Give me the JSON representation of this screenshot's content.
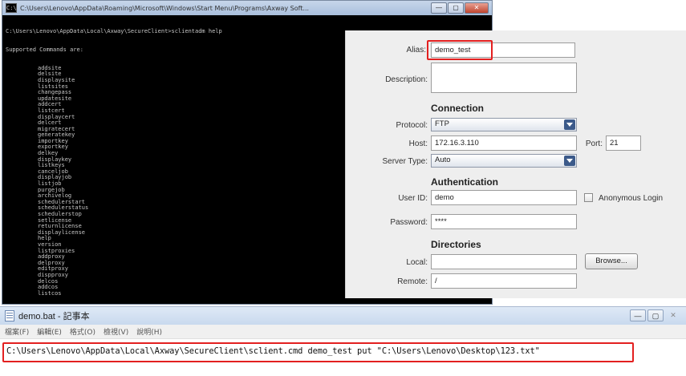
{
  "console": {
    "title": "C:\\Users\\Lenovo\\AppData\\Roaming\\Microsoft\\Windows\\Start Menu\\Programs\\Axway Soft...",
    "prompt_line": "C:\\Users\\Lenovo\\AppData\\Local\\Axway\\SecureClient>sclientadm help",
    "supported_line": "Supported Commands are:",
    "commands": [
      "addsite",
      "delsite",
      "displaysite",
      "listsites",
      "changepass",
      "updatesite",
      "addcert",
      "listcert",
      "displaycert",
      "delcert",
      "migratecert",
      "generatekey",
      "importkey",
      "exportkey",
      "delkey",
      "displaykey",
      "listkeys",
      "canceljob",
      "displayjob",
      "listjob",
      "purgejob",
      "archivelog",
      "schedulerstart",
      "schedulerstatus",
      "schedulerstop",
      "setlicense",
      "returnlicense",
      "displaylicense",
      "help",
      "version",
      "listproxies",
      "addproxy",
      "delproxy",
      "editproxy",
      "dispproxy",
      "delcos",
      "addcos",
      "listcos"
    ],
    "icon": "console-icon"
  },
  "form": {
    "alias_label": "Alias:",
    "alias_value": "demo_test",
    "description_label": "Description:",
    "description_value": "",
    "connection_title": "Connection",
    "protocol_label": "Protocol:",
    "protocol_value": "FTP",
    "host_label": "Host:",
    "host_value": "172.16.3.110",
    "port_label": "Port:",
    "port_value": "21",
    "server_type_label": "Server Type:",
    "server_type_value": "Auto",
    "authentication_title": "Authentication",
    "userid_label": "User ID:",
    "userid_value": "demo",
    "anonymous_label": "Anonymous Login",
    "password_label": "Password:",
    "password_value": "****",
    "directories_title": "Directories",
    "local_label": "Local:",
    "local_value": "",
    "browse_label": "Browse...",
    "remote_label": "Remote:",
    "remote_value": "/"
  },
  "notepad": {
    "title": "demo.bat - 記事本",
    "menus": [
      "檔案(F)",
      "編輯(E)",
      "格式(O)",
      "檢視(V)",
      "說明(H)"
    ],
    "content": "C:\\Users\\Lenovo\\AppData\\Local\\Axway\\SecureClient\\sclient.cmd demo_test put \"C:\\Users\\Lenovo\\Desktop\\123.txt\"",
    "window_buttons": [
      "—",
      "▢",
      "✕"
    ]
  },
  "colors": {
    "highlight": "#e32020",
    "console_bg": "#000000",
    "dialog_bg": "#eeeeee"
  }
}
